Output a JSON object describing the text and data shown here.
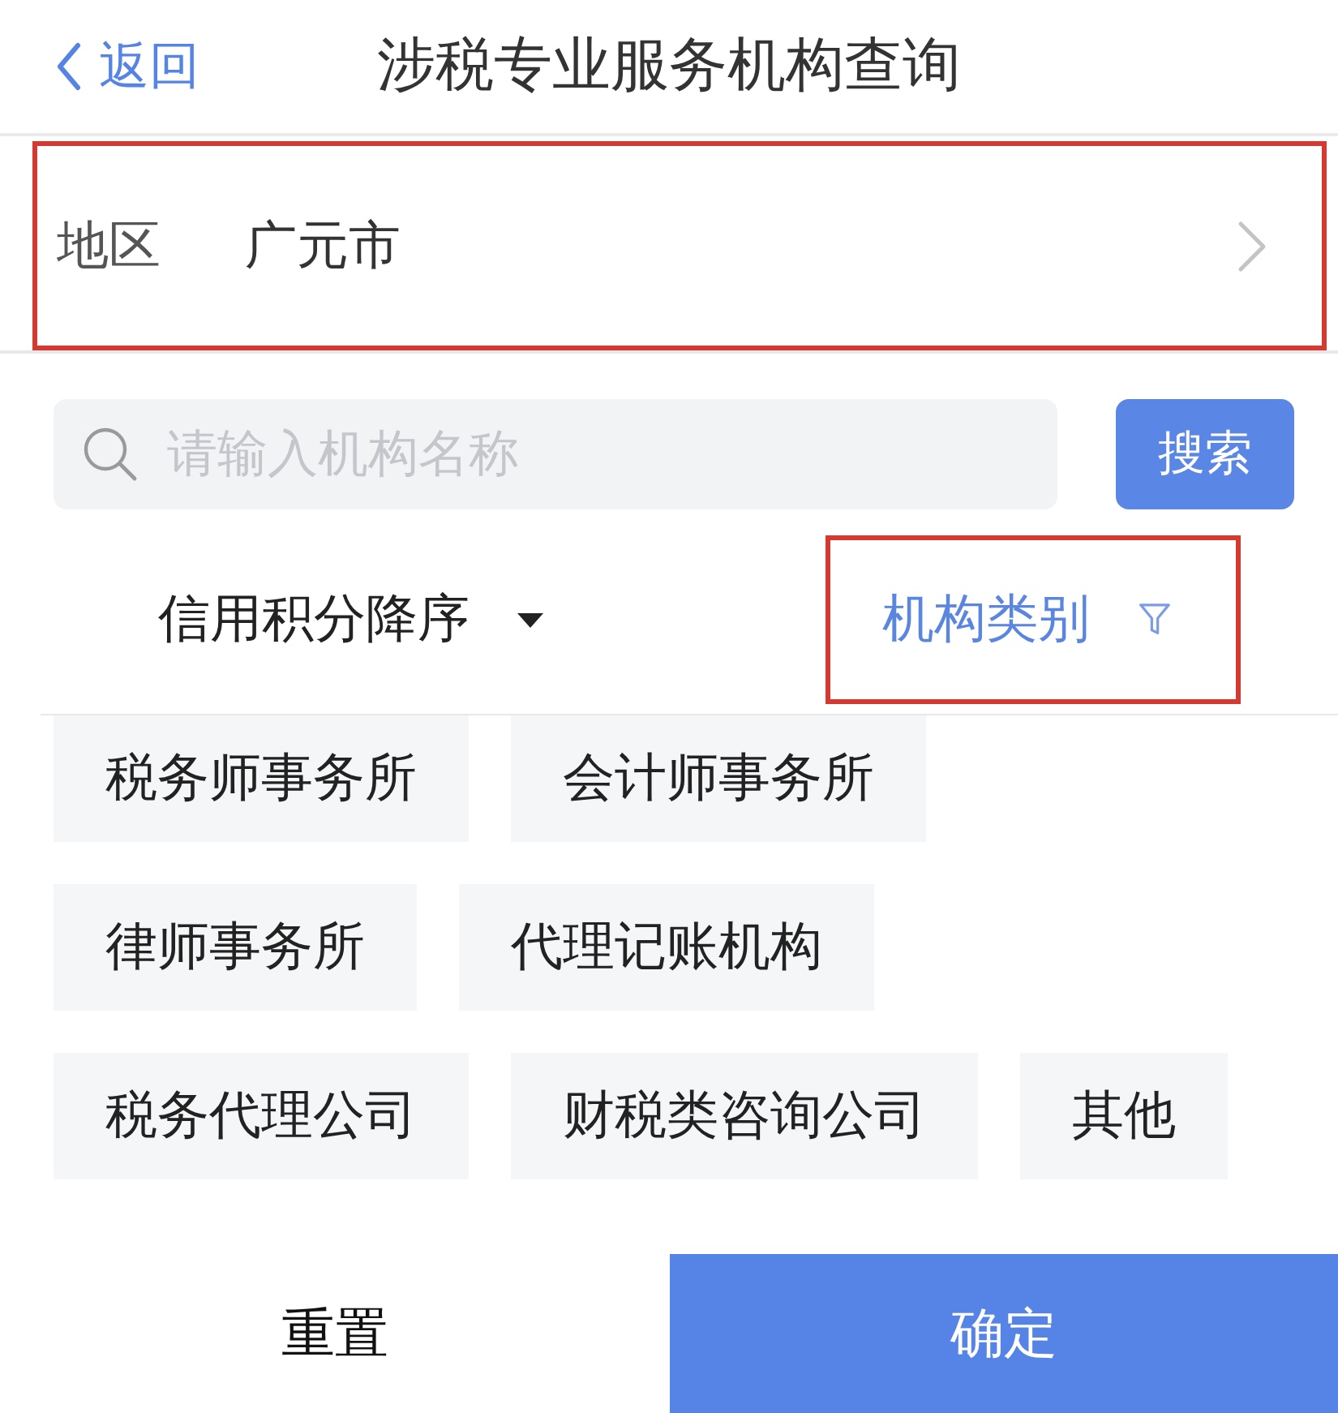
{
  "header": {
    "back": {
      "label": "返回"
    },
    "title": "涉税专业服务机构查询"
  },
  "region": {
    "label": "地区",
    "value": "广元市",
    "highlighted": true
  },
  "search": {
    "placeholder": "请输入机构名称",
    "button": "搜索"
  },
  "sort": {
    "label": "信用积分降序"
  },
  "category_filter": {
    "label": "机构类别",
    "expanded": true,
    "highlighted": true
  },
  "categories": [
    {
      "label": "税务师事务所",
      "selected": false
    },
    {
      "label": "会计师事务所",
      "selected": false
    },
    {
      "label": "律师事务所",
      "selected": false
    },
    {
      "label": "代理记账机构",
      "selected": false
    },
    {
      "label": "税务代理公司",
      "selected": false
    },
    {
      "label": "财税类咨询公司",
      "selected": false
    },
    {
      "label": "其他",
      "selected": false
    }
  ],
  "footer": {
    "reset": "重置",
    "confirm": "确定"
  }
}
